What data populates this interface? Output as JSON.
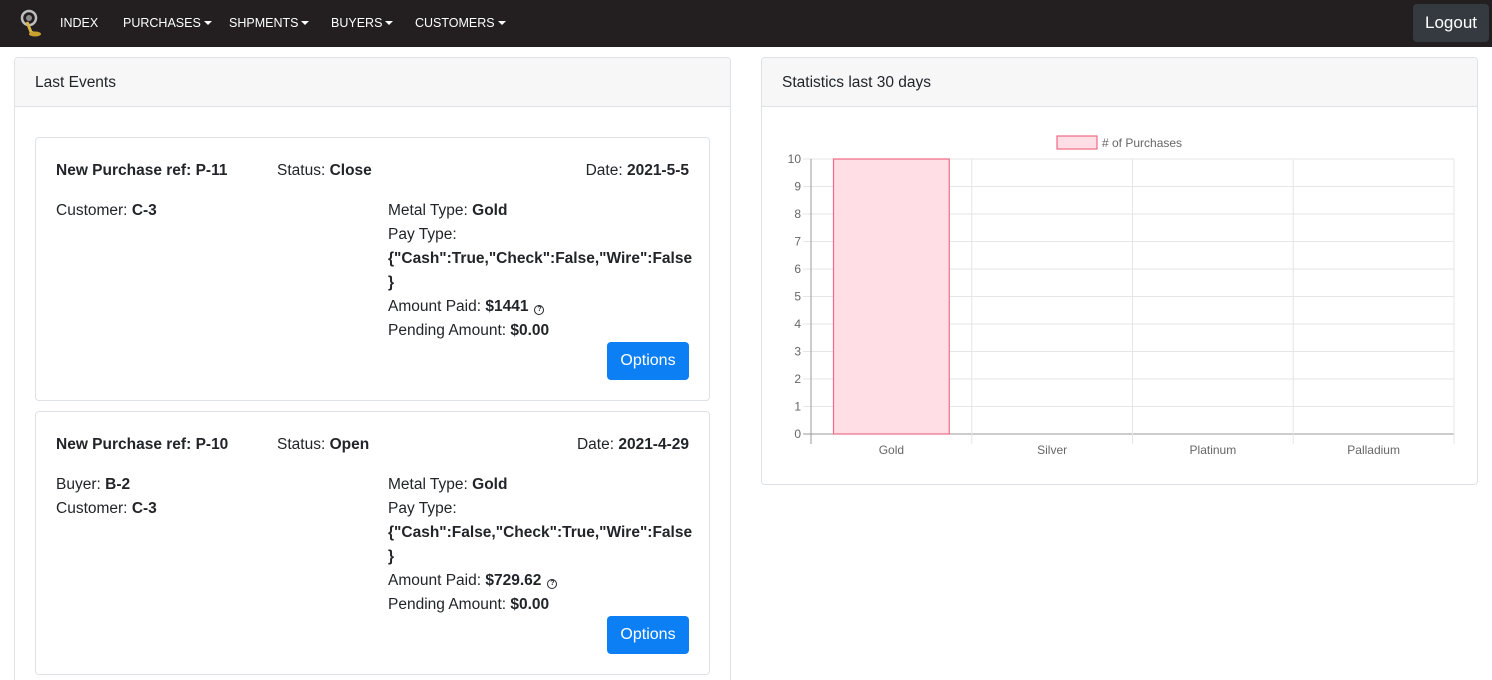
{
  "navbar": {
    "items": [
      {
        "label": "INDEX",
        "dropdown": false
      },
      {
        "label": "PURCHASES",
        "dropdown": true
      },
      {
        "label": "SHPMENTS",
        "dropdown": true
      },
      {
        "label": "BUYERS",
        "dropdown": true
      },
      {
        "label": "CUSTOMERS",
        "dropdown": true
      }
    ],
    "logout_label": "Logout"
  },
  "events_panel": {
    "title": "Last Events",
    "events": [
      {
        "ref_label": "New Purchase ref:",
        "ref_value": "P-11",
        "status_label": "Status:",
        "status_value": "Close",
        "date_label": "Date:",
        "date_value": "2021-5-5",
        "buyer_label": "",
        "buyer_value": "",
        "customer_label": "Customer:",
        "customer_value": "C-3",
        "metal_label": "Metal Type:",
        "metal_value": "Gold",
        "pay_label": "Pay Type:",
        "pay_value_line1": "{\"Cash\":True,\"Check\":False,\"Wire\":False",
        "pay_value_line2": "}",
        "amount_label": "Amount Paid:",
        "amount_value": "$1441",
        "pending_label": "Pending Amount:",
        "pending_value": "$0.00",
        "options_label": "Options"
      },
      {
        "ref_label": "New Purchase ref:",
        "ref_value": "P-10",
        "status_label": "Status:",
        "status_value": "Open",
        "date_label": "Date:",
        "date_value": "2021-4-29",
        "buyer_label": "Buyer:",
        "buyer_value": "B-2",
        "customer_label": "Customer:",
        "customer_value": "C-3",
        "metal_label": "Metal Type:",
        "metal_value": "Gold",
        "pay_label": "Pay Type:",
        "pay_value_line1": "{\"Cash\":False,\"Check\":True,\"Wire\":False",
        "pay_value_line2": "}",
        "amount_label": "Amount Paid:",
        "amount_value": "$729.62",
        "pending_label": "Pending Amount:",
        "pending_value": "$0.00",
        "options_label": "Options"
      }
    ]
  },
  "stats_panel": {
    "title": "Statistics last 30 days"
  },
  "colors": {
    "navbar_bg": "#231f20",
    "button_blue": "#0d7ff5",
    "bar_fill": "#ffdfe5",
    "bar_border": "#f06a87"
  },
  "chart_data": {
    "type": "bar",
    "categories": [
      "Gold",
      "Silver",
      "Platinum",
      "Palladium"
    ],
    "series": [
      {
        "name": "# of Purchases",
        "values": [
          10,
          0,
          0,
          0
        ]
      }
    ],
    "ylim": [
      0,
      10
    ],
    "yticks": [
      "0",
      "1",
      "2",
      "3",
      "4",
      "5",
      "6",
      "7",
      "8",
      "9",
      "10"
    ],
    "grid": true,
    "legend": "top"
  }
}
